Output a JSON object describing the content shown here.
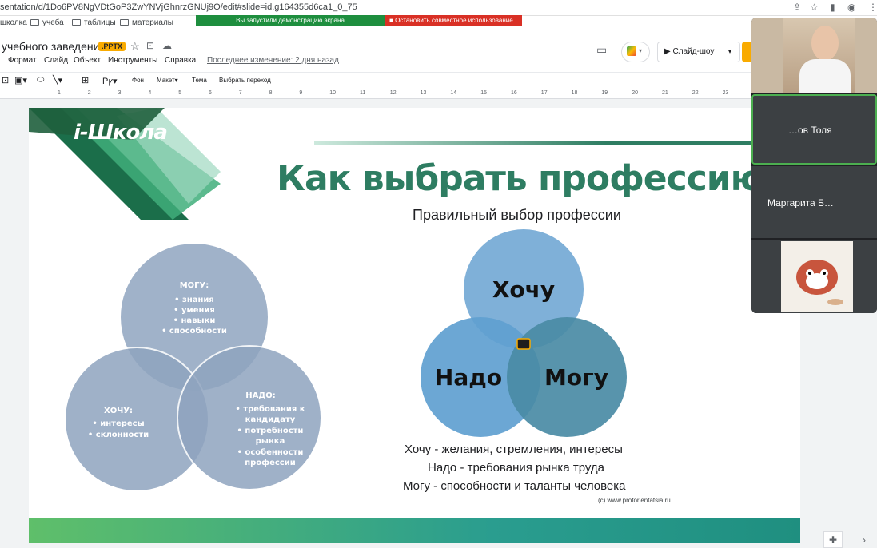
{
  "browser": {
    "url": "sentation/d/1Do6PV8NgVDtGoP3ZwYNVjGhnrzGNUj9O/edit#slide=id.g164355d6ca1_0_75"
  },
  "bookmarks": [
    {
      "label": "школка"
    },
    {
      "label": "учеба"
    },
    {
      "label": "таблицы"
    },
    {
      "label": "материалы"
    }
  ],
  "share": {
    "banner": "Вы запустили демонстрацию экрана",
    "stop": "Остановить совместное использование"
  },
  "doc": {
    "title": "учебного заведения",
    "badge": ".PPTX",
    "menus": [
      "Формат",
      "Слайд",
      "Объект",
      "Инструменты",
      "Справка"
    ],
    "last_edit": "Последнее изменение: 2 дня назад",
    "slideshow_label": "Слайд-шоу"
  },
  "toolbar": {
    "background": "Фон",
    "layout": "Макет",
    "theme": "Тема",
    "transition": "Выбрать переход"
  },
  "ruler": [
    "1",
    "2",
    "3",
    "4",
    "5",
    "6",
    "7",
    "8",
    "9",
    "10",
    "11",
    "12",
    "13",
    "14",
    "15",
    "16",
    "17",
    "18",
    "19",
    "20",
    "21",
    "22",
    "23"
  ],
  "slide": {
    "logo": "i-Школа",
    "title": "Как выбрать профессию",
    "subtitle": "Правильный выбор профессии",
    "left_venn": {
      "top": {
        "heading": "МОГУ:",
        "items": [
          "• знания",
          "• умения",
          "• навыки",
          "• способности"
        ]
      },
      "left": {
        "heading": "ХОЧУ:",
        "items": [
          "• интересы",
          "• склонности"
        ]
      },
      "right": {
        "heading": "НАДО:",
        "items": [
          "• требования к",
          "кандидату",
          "• потребности",
          "рынка",
          "• особенности",
          "профессии"
        ]
      }
    },
    "right_venn": {
      "top": "Хочу",
      "left": "Надо",
      "right": "Могу"
    },
    "legend": [
      {
        "term": "Хочу",
        "desc": " - желания, стремления, интересы"
      },
      {
        "term": "Надо",
        "desc": " - требования рынка труда"
      },
      {
        "term": "Могу",
        "desc": " - способности и таланты человека"
      }
    ],
    "credit": "(c) www.proforientatsia.ru"
  },
  "participants": [
    {
      "name": ""
    },
    {
      "name": "…ов Толя"
    },
    {
      "name": "Маргарита Б…"
    },
    {
      "name": ""
    }
  ],
  "colors": {
    "accent": "#2e7d62",
    "venn_light": "#7fb0d8",
    "venn_dark": "#4a8ba5",
    "venn_grey": "#8fa4bf"
  }
}
